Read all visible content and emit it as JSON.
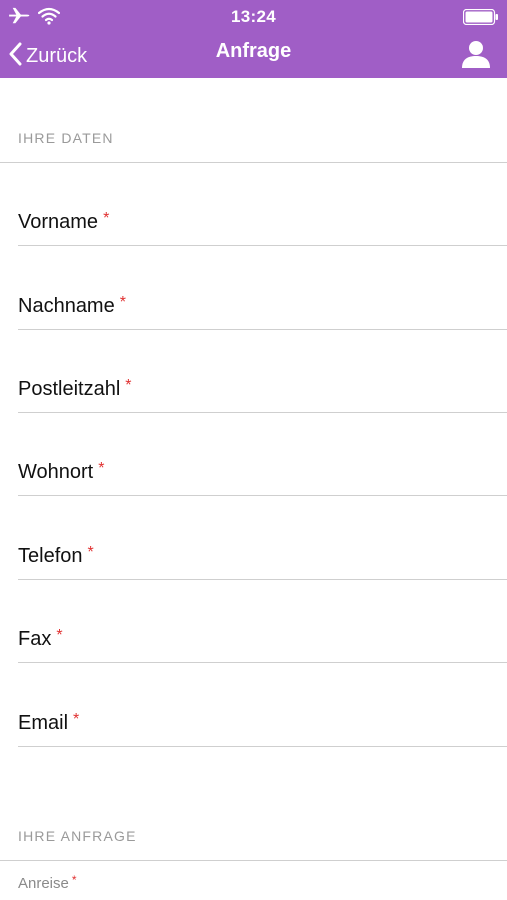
{
  "status_bar": {
    "time": "13:24",
    "icons": [
      "airplane-icon",
      "wifi-icon",
      "battery-icon"
    ]
  },
  "nav": {
    "back_label": "Zurück",
    "title": "Anfrage",
    "right_icon": "person-icon",
    "background": "#a05ec6"
  },
  "sections": {
    "personal_header": "IHRE DATEN",
    "request_header": "IHRE ANFRAGE"
  },
  "fields": [
    {
      "label": "Vorname",
      "required": "*"
    },
    {
      "label": "Nachname",
      "required": "*"
    },
    {
      "label": "Postleitzahl",
      "required": "*"
    },
    {
      "label": "Wohnort",
      "required": "*"
    },
    {
      "label": "Telefon",
      "required": "*"
    },
    {
      "label": "Fax",
      "required": "*"
    },
    {
      "label": "Email",
      "required": "*"
    }
  ],
  "request_fields": [
    {
      "label": "Anreise",
      "required": "*"
    }
  ],
  "colors": {
    "accent": "#a05ec6",
    "required": "#e03030",
    "section_text": "#9a9a9a",
    "divider": "#cfcfcf"
  }
}
